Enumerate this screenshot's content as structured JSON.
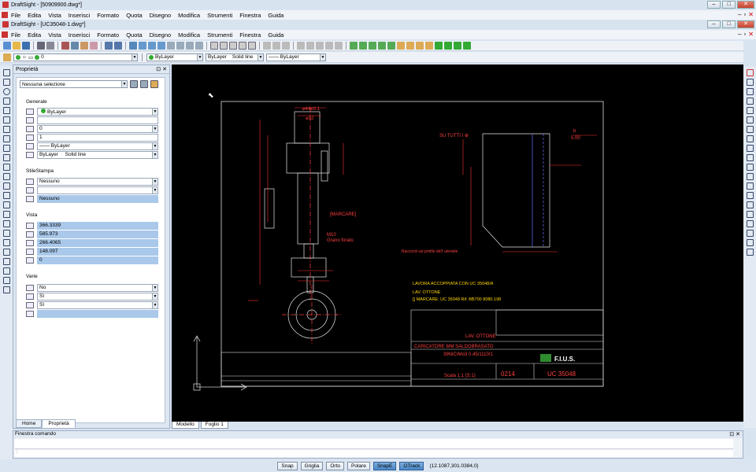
{
  "windows": [
    {
      "title": "DraftSight - [50909900.dwg*]"
    },
    {
      "title": "DraftSight - [UC35048-1.dwg*]"
    }
  ],
  "menu": [
    "File",
    "Edita",
    "Vista",
    "Inserisci",
    "Formato",
    "Quota",
    "Disegno",
    "Modifica",
    "Strumenti",
    "Finestra",
    "Guida"
  ],
  "layer_toolbar": {
    "layer": "0",
    "color": "ByLayer",
    "linetype_name": "ByLayer",
    "linetype_desc": "Solid line",
    "lineweight": "—— ByLayer"
  },
  "properties": {
    "header": "Proprietà",
    "selection": "Nessuna selezione",
    "sections": {
      "generale": "Generale",
      "stile_stampa": "StileStampa",
      "vista": "Vista",
      "varie": "Varie"
    },
    "generale": {
      "color": "ByLayer",
      "layer": "0",
      "scale": "1",
      "linetype": "—— ByLayer",
      "lineweight": "ByLayer",
      "lineweight_desc": "Solid line"
    },
    "stile_stampa": {
      "style": "Nessuno",
      "table": "",
      "applied": "Nessuno"
    },
    "vista": [
      "366.3339",
      "585.973",
      "266.4065",
      "148.097",
      "0"
    ],
    "varie": [
      "No",
      "Sì",
      "Sì",
      ""
    ],
    "tabs": [
      "Home",
      "Proprietà"
    ]
  },
  "canvas_tabs": [
    "Modello",
    "Foglio 1"
  ],
  "drawing": {
    "note1": "SU TUTTI I ⊕",
    "note2": "LAVORA ACCOPPIATA CON UC 35048/A",
    "note3": "LAV. OTTONE",
    "note4": "[] MARCARE: UC 35048 Rif. BB700 8080.198",
    "marcare": "[MARCARE]",
    "m10": "M10",
    "grano": "Grano forato",
    "dim_44": "⌀44±0.1",
    "dim_32": "⌀32",
    "dim_5": "5.00",
    "dim_b": "b",
    "raccordi": "Raccordi sul profilo dell' utensile",
    "materiale": "39NiCrMo3  0.45/1110/1",
    "descr": "CARICATORE MM SALDOBRASATO",
    "lav": "LAV. OTTONE",
    "codice": "0214",
    "disegno": "UC 35048",
    "scala": "Scala 1:1  (S:1)",
    "brand": "F.I.U.S."
  },
  "command": {
    "header": "Finestra comando",
    "prompt": ":"
  },
  "status": {
    "buttons": [
      "Snap",
      "Griglia",
      "Orto",
      "Polare",
      "SnapE",
      "OTrack"
    ],
    "active": [
      false,
      false,
      false,
      false,
      true,
      true
    ],
    "coords": "(12.1087,301.0384,0)"
  },
  "colors": {
    "canvas": "#000000",
    "lines_main": "#e8e8e8",
    "dim": "#ff3030",
    "title_yellow": "#ffd700",
    "highlight": "#a9c8ea"
  }
}
